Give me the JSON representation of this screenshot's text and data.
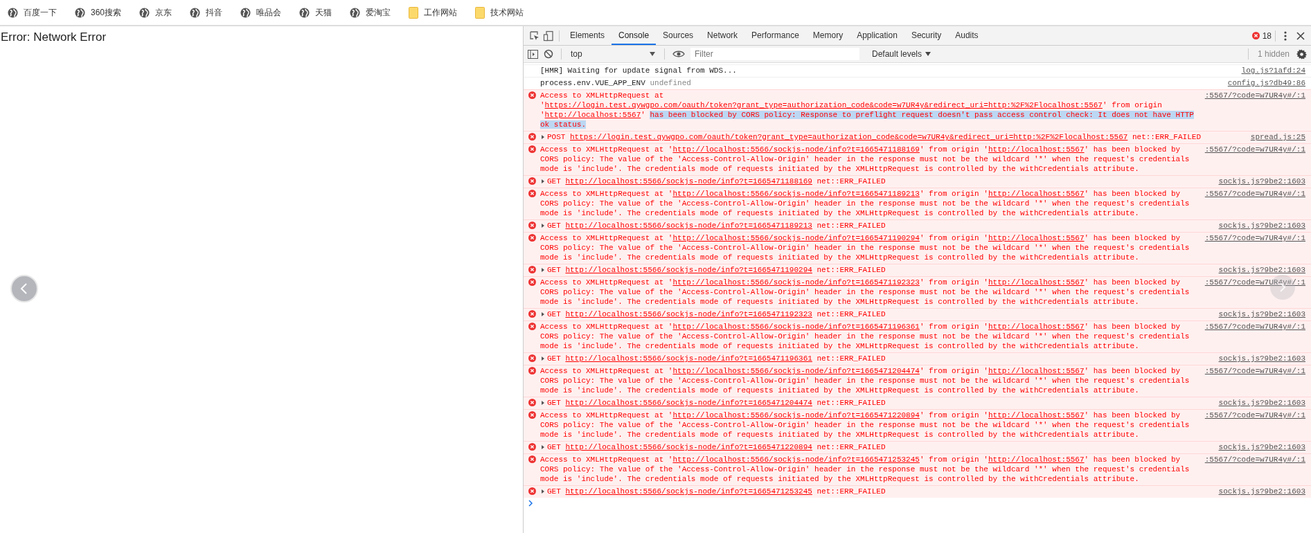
{
  "bookmarks": [
    {
      "kind": "site",
      "label": "百度一下"
    },
    {
      "kind": "site",
      "label": "360搜索"
    },
    {
      "kind": "site",
      "label": "京东"
    },
    {
      "kind": "site",
      "label": "抖音"
    },
    {
      "kind": "site",
      "label": "唯品会"
    },
    {
      "kind": "site",
      "label": "天猫"
    },
    {
      "kind": "site",
      "label": "爱淘宝"
    },
    {
      "kind": "folder",
      "label": "工作网站"
    },
    {
      "kind": "folder",
      "label": "技术网站"
    }
  ],
  "page": {
    "message": "Error: Network Error"
  },
  "devtools": {
    "tabs": [
      {
        "label": "Elements",
        "selected": false
      },
      {
        "label": "Console",
        "selected": true
      },
      {
        "label": "Sources",
        "selected": false
      },
      {
        "label": "Network",
        "selected": false
      },
      {
        "label": "Performance",
        "selected": false
      },
      {
        "label": "Memory",
        "selected": false
      },
      {
        "label": "Application",
        "selected": false
      },
      {
        "label": "Security",
        "selected": false
      },
      {
        "label": "Audits",
        "selected": false
      }
    ],
    "error_count": "18",
    "context": "top",
    "filter": {
      "placeholder": "Filter"
    },
    "levels": "Default levels",
    "hidden": "1 hidden"
  },
  "messages": [
    {
      "kind": "log",
      "parts": [
        {
          "kind": "text",
          "text": "[HMR] Waiting for update signal from WDS..."
        }
      ],
      "source": "log.js?1afd:24"
    },
    {
      "kind": "log",
      "parts": [
        {
          "kind": "text",
          "text": "process.env.VUE_APP_ENV "
        },
        {
          "kind": "dim",
          "text": "undefined"
        }
      ],
      "source": "config.js?db49:86"
    },
    {
      "kind": "error",
      "parts": [
        {
          "kind": "text",
          "text": "Access to XMLHttpRequest at '"
        },
        {
          "kind": "link",
          "text": "https://login.test.qywgpo.com/oauth/token?grant_type=authorization_code&code=w7UR4y&redirect_uri=http:%2F%2Flocalhost:5567"
        },
        {
          "kind": "text",
          "text": "' from origin '"
        },
        {
          "kind": "link",
          "text": "http://localhost:5567"
        },
        {
          "kind": "text",
          "text": "' "
        },
        {
          "kind": "selection",
          "text": "has been blocked by CORS policy: Response to preflight request doesn't pass access control check: It does not have HTTP ok status."
        }
      ],
      "source": ":5567/?code=w7UR4y#/:1"
    },
    {
      "kind": "request",
      "expanded": false,
      "parts": [
        {
          "kind": "text",
          "text": "POST "
        },
        {
          "kind": "link",
          "text": "https://login.test.qywgpo.com/oauth/token?grant_type=authorization_code&code=w7UR4y&redirect_uri=http:%2F%2Flocalhost:5567"
        },
        {
          "kind": "text",
          "text": " net::ERR_FAILED"
        }
      ],
      "source": "spread.js:25"
    },
    {
      "kind": "error",
      "parts": [
        {
          "kind": "text",
          "text": "Access to XMLHttpRequest at '"
        },
        {
          "kind": "link",
          "text": "http://localhost:5566/sockjs-node/info?t=1665471188169"
        },
        {
          "kind": "text",
          "text": "' from origin '"
        },
        {
          "kind": "link",
          "text": "http://localhost:5567"
        },
        {
          "kind": "text",
          "text": "' has been blocked by CORS policy: The value of the 'Access-Control-Allow-Origin' header in the response must not be the wildcard '*' when the request's credentials mode is 'include'. The credentials mode of requests initiated by the XMLHttpRequest is controlled by the withCredentials attribute."
        }
      ],
      "source": ":5567/?code=w7UR4y#/:1"
    },
    {
      "kind": "request",
      "expanded": false,
      "parts": [
        {
          "kind": "text",
          "text": "GET "
        },
        {
          "kind": "link",
          "text": "http://localhost:5566/sockjs-node/info?t=1665471188169"
        },
        {
          "kind": "text",
          "text": " net::ERR_FAILED"
        }
      ],
      "source": "sockjs.js?9be2:1603"
    },
    {
      "kind": "error",
      "parts": [
        {
          "kind": "text",
          "text": "Access to XMLHttpRequest at '"
        },
        {
          "kind": "link",
          "text": "http://localhost:5566/sockjs-node/info?t=1665471189213"
        },
        {
          "kind": "text",
          "text": "' from origin '"
        },
        {
          "kind": "link",
          "text": "http://localhost:5567"
        },
        {
          "kind": "text",
          "text": "' has been blocked by CORS policy: The value of the 'Access-Control-Allow-Origin' header in the response must not be the wildcard '*' when the request's credentials mode is 'include'. The credentials mode of requests initiated by the XMLHttpRequest is controlled by the withCredentials attribute."
        }
      ],
      "source": ":5567/?code=w7UR4y#/:1"
    },
    {
      "kind": "request",
      "expanded": false,
      "parts": [
        {
          "kind": "text",
          "text": "GET "
        },
        {
          "kind": "link",
          "text": "http://localhost:5566/sockjs-node/info?t=1665471189213"
        },
        {
          "kind": "text",
          "text": " net::ERR_FAILED"
        }
      ],
      "source": "sockjs.js?9be2:1603"
    },
    {
      "kind": "error",
      "parts": [
        {
          "kind": "text",
          "text": "Access to XMLHttpRequest at '"
        },
        {
          "kind": "link",
          "text": "http://localhost:5566/sockjs-node/info?t=1665471190294"
        },
        {
          "kind": "text",
          "text": "' from origin '"
        },
        {
          "kind": "link",
          "text": "http://localhost:5567"
        },
        {
          "kind": "text",
          "text": "' has been blocked by CORS policy: The value of the 'Access-Control-Allow-Origin' header in the response must not be the wildcard '*' when the request's credentials mode is 'include'. The credentials mode of requests initiated by the XMLHttpRequest is controlled by the withCredentials attribute."
        }
      ],
      "source": ":5567/?code=w7UR4y#/:1"
    },
    {
      "kind": "request",
      "expanded": false,
      "parts": [
        {
          "kind": "text",
          "text": "GET "
        },
        {
          "kind": "link",
          "text": "http://localhost:5566/sockjs-node/info?t=1665471190294"
        },
        {
          "kind": "text",
          "text": " net::ERR_FAILED"
        }
      ],
      "source": "sockjs.js?9be2:1603"
    },
    {
      "kind": "error",
      "parts": [
        {
          "kind": "text",
          "text": "Access to XMLHttpRequest at '"
        },
        {
          "kind": "link",
          "text": "http://localhost:5566/sockjs-node/info?t=1665471192323"
        },
        {
          "kind": "text",
          "text": "' from origin '"
        },
        {
          "kind": "link",
          "text": "http://localhost:5567"
        },
        {
          "kind": "text",
          "text": "' has been blocked by CORS policy: The value of the 'Access-Control-Allow-Origin' header in the response must not be the wildcard '*' when the request's credentials mode is 'include'. The credentials mode of requests initiated by the XMLHttpRequest is controlled by the withCredentials attribute."
        }
      ],
      "source": ":5567/?code=w7UR4y#/:1"
    },
    {
      "kind": "request",
      "expanded": false,
      "parts": [
        {
          "kind": "text",
          "text": "GET "
        },
        {
          "kind": "link",
          "text": "http://localhost:5566/sockjs-node/info?t=1665471192323"
        },
        {
          "kind": "text",
          "text": " net::ERR_FAILED"
        }
      ],
      "source": "sockjs.js?9be2:1603"
    },
    {
      "kind": "error",
      "parts": [
        {
          "kind": "text",
          "text": "Access to XMLHttpRequest at '"
        },
        {
          "kind": "link",
          "text": "http://localhost:5566/sockjs-node/info?t=1665471196361"
        },
        {
          "kind": "text",
          "text": "' from origin '"
        },
        {
          "kind": "link",
          "text": "http://localhost:5567"
        },
        {
          "kind": "text",
          "text": "' has been blocked by CORS policy: The value of the 'Access-Control-Allow-Origin' header in the response must not be the wildcard '*' when the request's credentials mode is 'include'. The credentials mode of requests initiated by the XMLHttpRequest is controlled by the withCredentials attribute."
        }
      ],
      "source": ":5567/?code=w7UR4y#/:1"
    },
    {
      "kind": "request",
      "expanded": false,
      "parts": [
        {
          "kind": "text",
          "text": "GET "
        },
        {
          "kind": "link",
          "text": "http://localhost:5566/sockjs-node/info?t=1665471196361"
        },
        {
          "kind": "text",
          "text": " net::ERR_FAILED"
        }
      ],
      "source": "sockjs.js?9be2:1603"
    },
    {
      "kind": "error",
      "parts": [
        {
          "kind": "text",
          "text": "Access to XMLHttpRequest at '"
        },
        {
          "kind": "link",
          "text": "http://localhost:5566/sockjs-node/info?t=1665471204474"
        },
        {
          "kind": "text",
          "text": "' from origin '"
        },
        {
          "kind": "link",
          "text": "http://localhost:5567"
        },
        {
          "kind": "text",
          "text": "' has been blocked by CORS policy: The value of the 'Access-Control-Allow-Origin' header in the response must not be the wildcard '*' when the request's credentials mode is 'include'. The credentials mode of requests initiated by the XMLHttpRequest is controlled by the withCredentials attribute."
        }
      ],
      "source": ":5567/?code=w7UR4y#/:1"
    },
    {
      "kind": "request",
      "expanded": false,
      "parts": [
        {
          "kind": "text",
          "text": "GET "
        },
        {
          "kind": "link",
          "text": "http://localhost:5566/sockjs-node/info?t=1665471204474"
        },
        {
          "kind": "text",
          "text": " net::ERR_FAILED"
        }
      ],
      "source": "sockjs.js?9be2:1603"
    },
    {
      "kind": "error",
      "parts": [
        {
          "kind": "text",
          "text": "Access to XMLHttpRequest at '"
        },
        {
          "kind": "link",
          "text": "http://localhost:5566/sockjs-node/info?t=1665471220894"
        },
        {
          "kind": "text",
          "text": "' from origin '"
        },
        {
          "kind": "link",
          "text": "http://localhost:5567"
        },
        {
          "kind": "text",
          "text": "' has been blocked by CORS policy: The value of the 'Access-Control-Allow-Origin' header in the response must not be the wildcard '*' when the request's credentials mode is 'include'. The credentials mode of requests initiated by the XMLHttpRequest is controlled by the withCredentials attribute."
        }
      ],
      "source": ":5567/?code=w7UR4y#/:1"
    },
    {
      "kind": "request",
      "expanded": false,
      "parts": [
        {
          "kind": "text",
          "text": "GET "
        },
        {
          "kind": "link",
          "text": "http://localhost:5566/sockjs-node/info?t=1665471220894"
        },
        {
          "kind": "text",
          "text": " net::ERR_FAILED"
        }
      ],
      "source": "sockjs.js?9be2:1603"
    },
    {
      "kind": "error",
      "parts": [
        {
          "kind": "text",
          "text": "Access to XMLHttpRequest at '"
        },
        {
          "kind": "link",
          "text": "http://localhost:5566/sockjs-node/info?t=1665471253245"
        },
        {
          "kind": "text",
          "text": "' from origin '"
        },
        {
          "kind": "link",
          "text": "http://localhost:5567"
        },
        {
          "kind": "text",
          "text": "' has been blocked by CORS policy: The value of the 'Access-Control-Allow-Origin' header in the response must not be the wildcard '*' when the request's credentials mode is 'include'. The credentials mode of requests initiated by the XMLHttpRequest is controlled by the withCredentials attribute."
        }
      ],
      "source": ":5567/?code=w7UR4y#/:1"
    },
    {
      "kind": "request",
      "expanded": false,
      "parts": [
        {
          "kind": "text",
          "text": "GET "
        },
        {
          "kind": "link",
          "text": "http://localhost:5566/sockjs-node/info?t=1665471253245"
        },
        {
          "kind": "text",
          "text": " net::ERR_FAILED"
        }
      ],
      "source": "sockjs.js?9be2:1603"
    }
  ]
}
